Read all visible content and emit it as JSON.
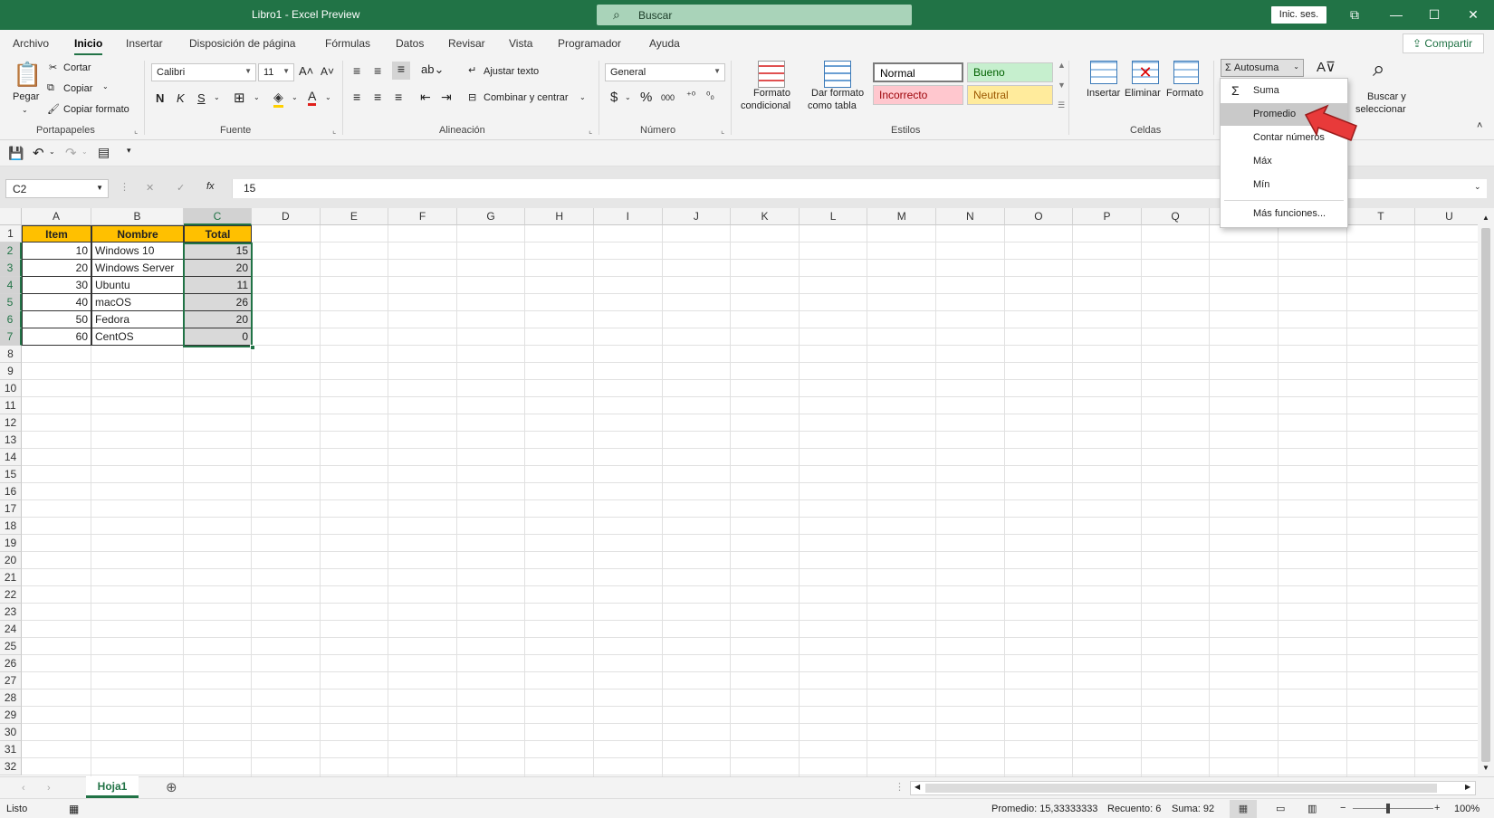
{
  "titlebar": {
    "title": "Libro1 - Excel Preview",
    "search_placeholder": "Buscar",
    "signin": "Inic. ses."
  },
  "menu": {
    "tabs": [
      "Archivo",
      "Inicio",
      "Insertar",
      "Disposición de página",
      "Fórmulas",
      "Datos",
      "Revisar",
      "Vista",
      "Programador",
      "Ayuda"
    ],
    "active": "Inicio",
    "share": "Compartir"
  },
  "ribbon": {
    "clipboard": {
      "paste": "Pegar",
      "cut": "Cortar",
      "copy": "Copiar",
      "format_painter": "Copiar formato",
      "label": "Portapapeles"
    },
    "font": {
      "name": "Calibri",
      "size": "11",
      "bold": "N",
      "italic": "K",
      "underline": "S",
      "label": "Fuente"
    },
    "alignment": {
      "wrap": "Ajustar texto",
      "merge": "Combinar y centrar",
      "label": "Alineación"
    },
    "number": {
      "format": "General",
      "label": "Número"
    },
    "styles": {
      "cond_format_1": "Formato",
      "cond_format_2": "condicional",
      "table_format_1": "Dar formato",
      "table_format_2": "como tabla",
      "normal": "Normal",
      "bueno": "Bueno",
      "incorrecto": "Incorrecto",
      "neutral": "Neutral",
      "label": "Estilos"
    },
    "cells": {
      "insert": "Insertar",
      "delete": "Eliminar",
      "format": "Formato",
      "label": "Celdas"
    },
    "editing": {
      "autosum": "Autosuma",
      "find_1": "Buscar y",
      "find_2": "seleccionar"
    }
  },
  "autosum_menu": {
    "items": [
      "Suma",
      "Promedio",
      "Contar números",
      "Máx",
      "Mín",
      "Más funciones..."
    ],
    "highlighted": "Promedio"
  },
  "formula": {
    "namebox": "C2",
    "value": "15"
  },
  "columns": [
    "A",
    "B",
    "C",
    "D",
    "E",
    "F",
    "G",
    "H",
    "I",
    "J",
    "K",
    "L",
    "M",
    "N",
    "O",
    "P",
    "Q",
    "R",
    "S",
    "T",
    "U"
  ],
  "rows": [
    "1",
    "2",
    "3",
    "4",
    "5",
    "6",
    "7",
    "8",
    "9",
    "10",
    "11",
    "12",
    "13",
    "14",
    "15",
    "16",
    "17",
    "18",
    "19",
    "20",
    "21",
    "22",
    "23",
    "24",
    "25",
    "26",
    "27",
    "28",
    "29",
    "30",
    "31",
    "32"
  ],
  "table": {
    "headers": [
      "Item",
      "Nombre",
      "Total"
    ],
    "data": [
      [
        "10",
        "Windows 10",
        "15"
      ],
      [
        "20",
        "Windows Server",
        "20"
      ],
      [
        "30",
        "Ubuntu",
        "11"
      ],
      [
        "40",
        "macOS",
        "26"
      ],
      [
        "50",
        "Fedora",
        "20"
      ],
      [
        "60",
        "CentOS",
        "0"
      ]
    ]
  },
  "sheets": {
    "active": "Hoja1"
  },
  "status": {
    "ready": "Listo",
    "avg": "Promedio: 15,33333333",
    "count": "Recuento: 6",
    "sum": "Suma: 92",
    "zoom": "100%"
  },
  "colors": {
    "accent": "#217346",
    "header_fill": "#ffc000",
    "selection": "#d9d9d9"
  }
}
